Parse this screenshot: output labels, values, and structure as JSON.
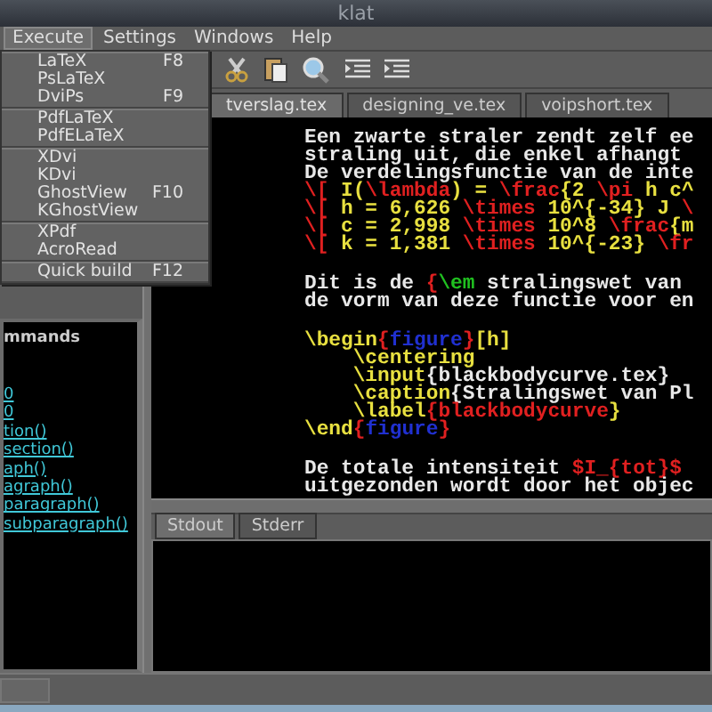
{
  "window": {
    "title": "klat"
  },
  "menubar": [
    {
      "label": "Execute",
      "selected": true
    },
    {
      "label": "Settings",
      "selected": false
    },
    {
      "label": "Windows",
      "selected": false
    },
    {
      "label": "Help",
      "selected": false
    }
  ],
  "menu": {
    "groups": [
      {
        "items": [
          {
            "label": "LaTeX",
            "shortcut": "F8"
          },
          {
            "label": "PsLaTeX"
          },
          {
            "label": "DviPs",
            "shortcut": "F9"
          }
        ]
      },
      {
        "items": [
          {
            "label": "PdfLaTeX"
          },
          {
            "label": "PdfELaTeX"
          }
        ]
      },
      {
        "items": [
          {
            "label": "XDvi"
          },
          {
            "label": "KDvi"
          },
          {
            "label": "GhostView",
            "shortcut": "F10"
          },
          {
            "label": "KGhostView"
          }
        ]
      },
      {
        "items": [
          {
            "label": "XPdf"
          },
          {
            "label": "AcroRead"
          }
        ]
      },
      {
        "items": [
          {
            "label": "Quick build",
            "shortcut": "F12"
          }
        ]
      }
    ]
  },
  "structure": {
    "heading": "mmands",
    "links": [
      "0",
      "0",
      "tion()",
      "section()",
      "aph()",
      "agraph()",
      "paragraph()",
      "subparagraph()"
    ]
  },
  "tabs": [
    {
      "label": "tverslag.tex",
      "selected": true
    },
    {
      "label": "designing_ve.tex",
      "selected": false
    },
    {
      "label": "voipshort.tex",
      "selected": false
    }
  ],
  "editor": {
    "paragraphs": [
      {
        "lines": [
          {
            "segments": [
              {
                "text": "Een zwarte straler zendt zelf ee",
                "color": "#e8e8e8"
              }
            ]
          },
          {
            "segments": [
              {
                "text": "straling uit, die enkel afhangt ",
                "color": "#e8e8e8"
              }
            ]
          },
          {
            "segments": [
              {
                "text": "De verdelingsfunctie van de inte",
                "color": "#e8e8e8"
              }
            ]
          },
          {
            "segments": [
              {
                "text": "\\[ ",
                "color": "#e02020"
              },
              {
                "text": "I(",
                "color": "#e8e040"
              },
              {
                "text": "\\lambda",
                "color": "#e02020"
              },
              {
                "text": ") = ",
                "color": "#e8e040"
              },
              {
                "text": "\\frac",
                "color": "#e02020"
              },
              {
                "text": "{2 ",
                "color": "#e8e040"
              },
              {
                "text": "\\pi",
                "color": "#e02020"
              },
              {
                "text": " h c^",
                "color": "#e8e040"
              }
            ]
          },
          {
            "segments": [
              {
                "text": "\\[ ",
                "color": "#e02020"
              },
              {
                "text": "h = 6,626 ",
                "color": "#e8e040"
              },
              {
                "text": "\\times",
                "color": "#e02020"
              },
              {
                "text": " 10^{-34} J ",
                "color": "#e8e040"
              },
              {
                "text": "\\",
                "color": "#e02020"
              }
            ]
          },
          {
            "segments": [
              {
                "text": "\\[ ",
                "color": "#e02020"
              },
              {
                "text": "c = 2,998 ",
                "color": "#e8e040"
              },
              {
                "text": "\\times",
                "color": "#e02020"
              },
              {
                "text": " 10^8 ",
                "color": "#e8e040"
              },
              {
                "text": "\\frac",
                "color": "#e02020"
              },
              {
                "text": "{m",
                "color": "#e8e040"
              }
            ]
          },
          {
            "segments": [
              {
                "text": "\\[ ",
                "color": "#e02020"
              },
              {
                "text": "k = 1,381 ",
                "color": "#e8e040"
              },
              {
                "text": "\\times",
                "color": "#e02020"
              },
              {
                "text": " 10^{-23} ",
                "color": "#e8e040"
              },
              {
                "text": "\\fr",
                "color": "#e02020"
              }
            ]
          }
        ]
      },
      {
        "lines": [
          {
            "segments": [
              {
                "text": "Dit is de ",
                "color": "#e8e8e8"
              },
              {
                "text": "{",
                "color": "#e02020"
              },
              {
                "text": "\\em",
                "color": "#20c020"
              },
              {
                "text": " stralingswet van ",
                "color": "#e8e8e8"
              }
            ]
          },
          {
            "segments": [
              {
                "text": "de vorm van deze functie voor en",
                "color": "#e8e8e8"
              }
            ]
          }
        ]
      },
      {
        "lines": [
          {
            "segments": [
              {
                "text": "\\begin",
                "color": "#e8e040"
              },
              {
                "text": "{",
                "color": "#e02020"
              },
              {
                "text": "figure",
                "color": "#2030d0"
              },
              {
                "text": "}",
                "color": "#e02020"
              },
              {
                "text": "[h]",
                "color": "#e8e040"
              }
            ]
          },
          {
            "segments": [
              {
                "text": "    \\centering",
                "color": "#e8e040"
              }
            ]
          },
          {
            "segments": [
              {
                "text": "    \\input",
                "color": "#e8e040"
              },
              {
                "text": "{blackbodycurve.tex}",
                "color": "#e8e8e8"
              }
            ]
          },
          {
            "segments": [
              {
                "text": "    \\caption",
                "color": "#e8e040"
              },
              {
                "text": "{Stralingswet van Pl",
                "color": "#e8e8e8"
              }
            ]
          },
          {
            "segments": [
              {
                "text": "    \\label",
                "color": "#e8e040"
              },
              {
                "text": "{",
                "color": "#e02020"
              },
              {
                "text": "blackbodycurve",
                "color": "#e02020"
              },
              {
                "text": "}",
                "color": "#e8e040"
              }
            ]
          },
          {
            "segments": [
              {
                "text": "\\end",
                "color": "#e8e040"
              },
              {
                "text": "{",
                "color": "#e02020"
              },
              {
                "text": "figure",
                "color": "#2030d0"
              },
              {
                "text": "}",
                "color": "#e02020"
              }
            ]
          }
        ]
      },
      {
        "lines": [
          {
            "segments": [
              {
                "text": "De totale intensiteit ",
                "color": "#e8e8e8"
              },
              {
                "text": "$I_{tot}$",
                "color": "#e02020"
              }
            ]
          },
          {
            "segments": [
              {
                "text": "uitgezonden wordt door het objec",
                "color": "#e8e8e8"
              }
            ]
          }
        ]
      }
    ]
  },
  "output_tabs": [
    {
      "label": "Stdout",
      "selected": true
    },
    {
      "label": "Stderr",
      "selected": false
    }
  ]
}
